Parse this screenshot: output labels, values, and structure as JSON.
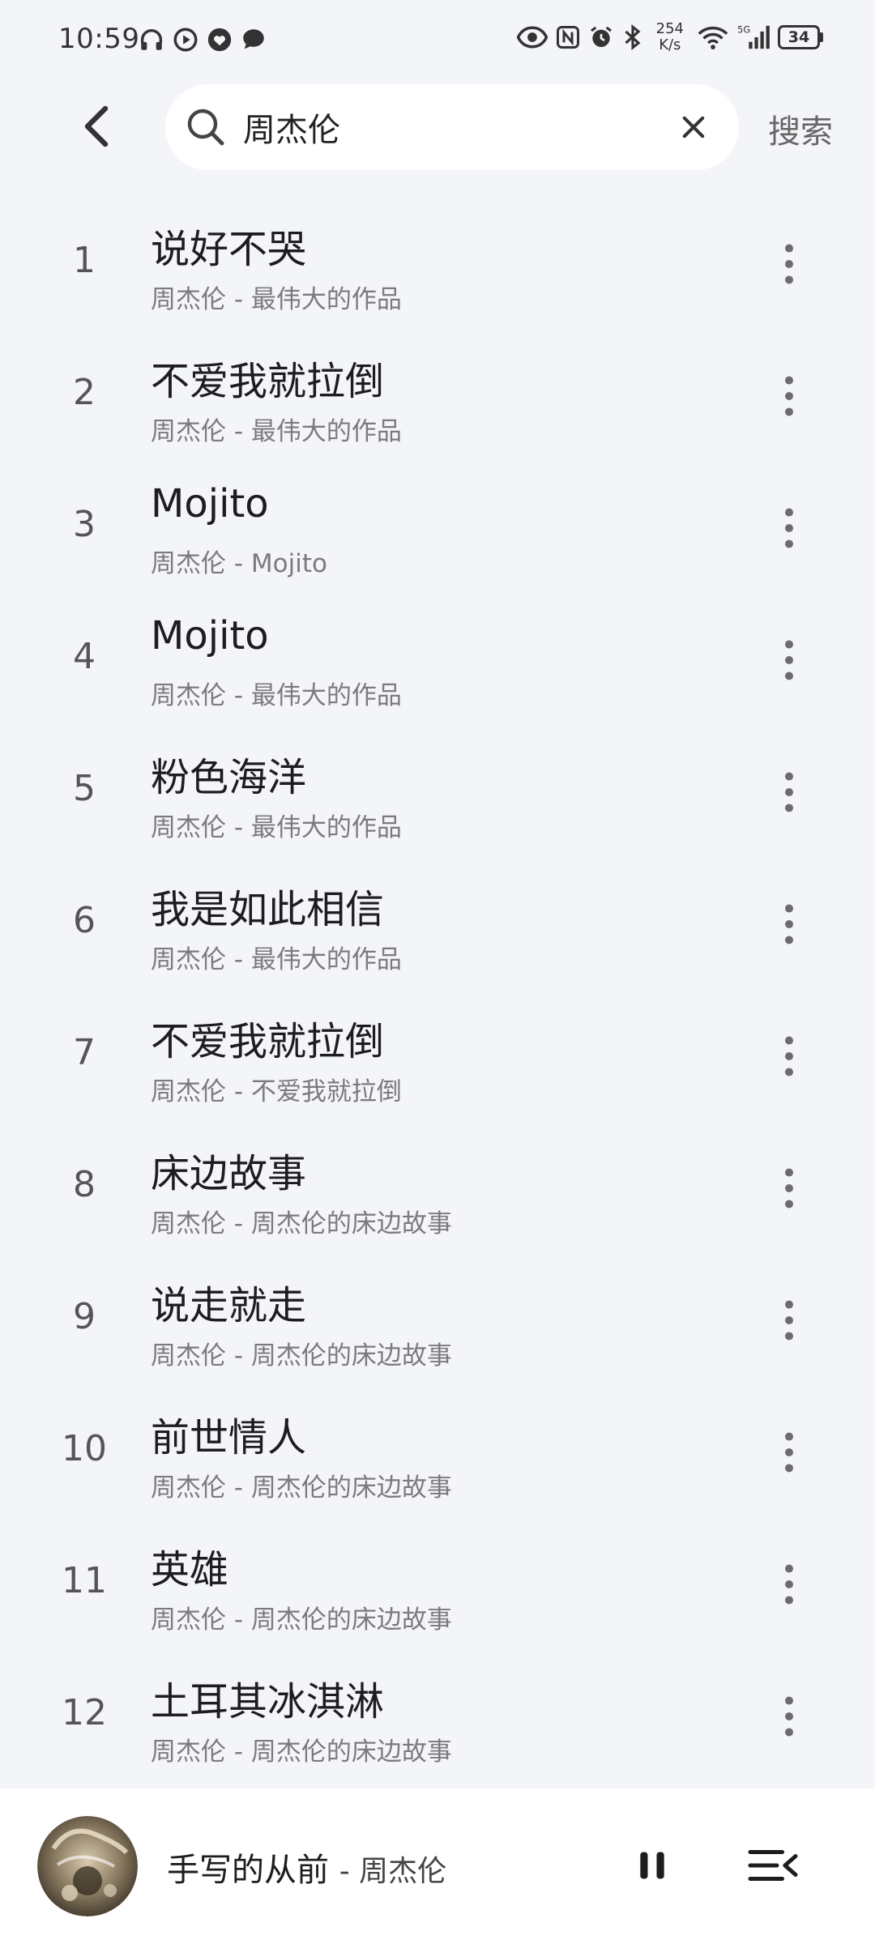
{
  "status_bar": {
    "time": "10:59",
    "left_icons": [
      "headphones-icon",
      "play-circle-icon",
      "heart-icon",
      "chat-bubble-icon"
    ],
    "net_speed_value": "254",
    "net_speed_unit": "K/s",
    "right_icons": [
      "eye-icon",
      "nfc-icon",
      "alarm-icon",
      "bluetooth-icon",
      "wifi-icon",
      "signal-5g-icon"
    ],
    "battery": "34"
  },
  "header": {
    "search_query": "周杰伦",
    "search_action_label": "搜索"
  },
  "songs": [
    {
      "index": "1",
      "title": "说好不哭",
      "subtitle": "周杰伦 - 最伟大的作品"
    },
    {
      "index": "2",
      "title": "不爱我就拉倒",
      "subtitle": "周杰伦 - 最伟大的作品"
    },
    {
      "index": "3",
      "title": "Mojito",
      "subtitle": "周杰伦 - Mojito"
    },
    {
      "index": "4",
      "title": "Mojito",
      "subtitle": "周杰伦 - 最伟大的作品"
    },
    {
      "index": "5",
      "title": "粉色海洋",
      "subtitle": "周杰伦 - 最伟大的作品"
    },
    {
      "index": "6",
      "title": "我是如此相信",
      "subtitle": "周杰伦 - 最伟大的作品"
    },
    {
      "index": "7",
      "title": "不爱我就拉倒",
      "subtitle": "周杰伦 - 不爱我就拉倒"
    },
    {
      "index": "8",
      "title": "床边故事",
      "subtitle": "周杰伦 - 周杰伦的床边故事"
    },
    {
      "index": "9",
      "title": "说走就走",
      "subtitle": "周杰伦 - 周杰伦的床边故事"
    },
    {
      "index": "10",
      "title": "前世情人",
      "subtitle": "周杰伦 - 周杰伦的床边故事"
    },
    {
      "index": "11",
      "title": "英雄",
      "subtitle": "周杰伦 - 周杰伦的床边故事"
    },
    {
      "index": "12",
      "title": "土耳其冰淇淋",
      "subtitle": "周杰伦 - 周杰伦的床边故事"
    }
  ],
  "player": {
    "title": "手写的从前",
    "artist": "- 周杰伦"
  }
}
